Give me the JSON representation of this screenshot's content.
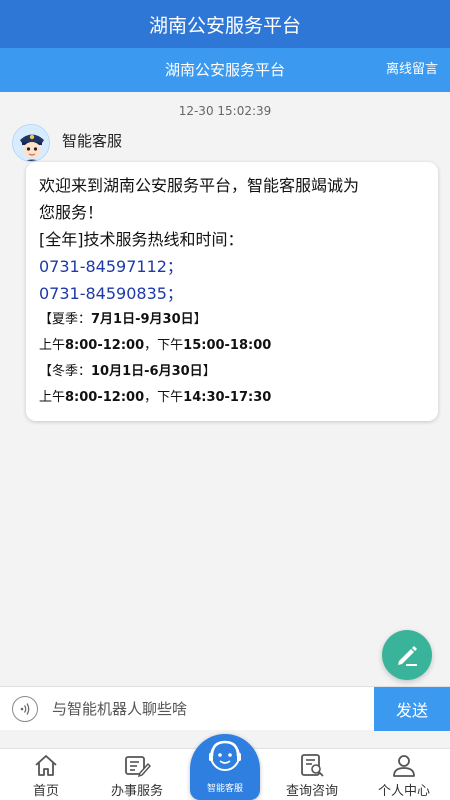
{
  "app": {
    "title": "湖南公安服务平台"
  },
  "header": {
    "title": "湖南公安服务平台",
    "offline_message": "离线留言"
  },
  "chat": {
    "timestamp": "12-30 15:02:39",
    "bot_name": "智能客服",
    "message": {
      "welcome": "欢迎来到湖南公安服务平台，智能客服竭诚为",
      "welcome_cont": "您服务！",
      "hotline_title": "[全年]技术服务热线和时间：",
      "phone1": "0731-84597112；",
      "phone2": "0731-84590835；",
      "summer_label": "【夏季：",
      "summer_range": "7月1日-9月30日",
      "summer_close": "】",
      "summer_am_prefix": "上午",
      "summer_am": "8:00-12:00",
      "summer_pm_prefix": "，下午",
      "summer_pm": "15:00-18:00",
      "winter_label": "【冬季：",
      "winter_range": "10月1日-6月30日",
      "winter_close": "】",
      "winter_am_prefix": "上午",
      "winter_am": "8:00-12:00",
      "winter_pm_prefix": "，下午",
      "winter_pm": "14:30-17:30"
    }
  },
  "input": {
    "placeholder": "与智能机器人聊些啥",
    "send_label": "发送"
  },
  "tabs": [
    {
      "label": "首页",
      "icon": "home-icon"
    },
    {
      "label": "办事服务",
      "icon": "service-icon"
    },
    {
      "label": "智能客服",
      "icon": "customer-service-icon"
    },
    {
      "label": "查询咨询",
      "icon": "query-icon"
    },
    {
      "label": "个人中心",
      "icon": "person-icon"
    }
  ],
  "colors": {
    "header": "#2e77d6",
    "subheader": "#3b9af0",
    "fab": "#39b49a",
    "phone": "#1e3aa8"
  }
}
